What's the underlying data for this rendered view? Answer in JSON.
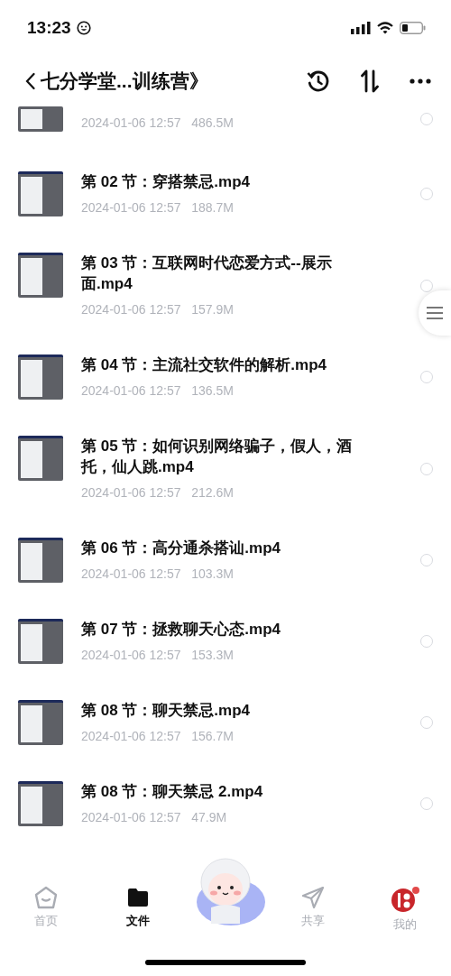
{
  "status_bar": {
    "time": "13:23"
  },
  "header": {
    "title": "七分学堂...训练营》"
  },
  "files": [
    {
      "meta": "2024-01-06 12:57   486.5M",
      "selected": false,
      "cut": true
    },
    {
      "title": "第 02 节：穿搭禁忌.mp4",
      "meta": "2024-01-06 12:57   188.7M",
      "selected": false
    },
    {
      "title": "第 03 节：互联网时代恋爱方式--展示面.mp4",
      "meta": "2024-01-06 12:57   157.9M",
      "selected": false
    },
    {
      "title": "第 04 节：主流社交软件的解析.mp4",
      "meta": "2024-01-06 12:57   136.5M",
      "selected": false
    },
    {
      "title": "第 05 节：如何识别网络骗子，假人，酒托，仙人跳.mp4",
      "meta": "2024-01-06 12:57   212.6M",
      "selected": false
    },
    {
      "title": "第 06 节：高分通杀搭讪.mp4",
      "meta": "2024-01-06 12:57   103.3M",
      "selected": false
    },
    {
      "title": "第 07 节：拯救聊天心态.mp4",
      "meta": "2024-01-06 12:57   153.3M",
      "selected": false
    },
    {
      "title": "第 08 节：聊天禁忌.mp4",
      "meta": "2024-01-06 12:57   156.7M",
      "selected": false
    },
    {
      "title": "第 08 节：聊天禁忌 2.mp4",
      "meta": "2024-01-06 12:57   47.9M",
      "selected": false
    }
  ],
  "tab_bar": [
    {
      "kind": "home",
      "label": "首页",
      "selected": false
    },
    {
      "kind": "files",
      "label": "文件",
      "selected": true
    },
    {
      "kind": "mascot"
    },
    {
      "kind": "share",
      "label": "共享",
      "selected": false
    },
    {
      "kind": "me",
      "label": "我的",
      "selected": false
    }
  ]
}
